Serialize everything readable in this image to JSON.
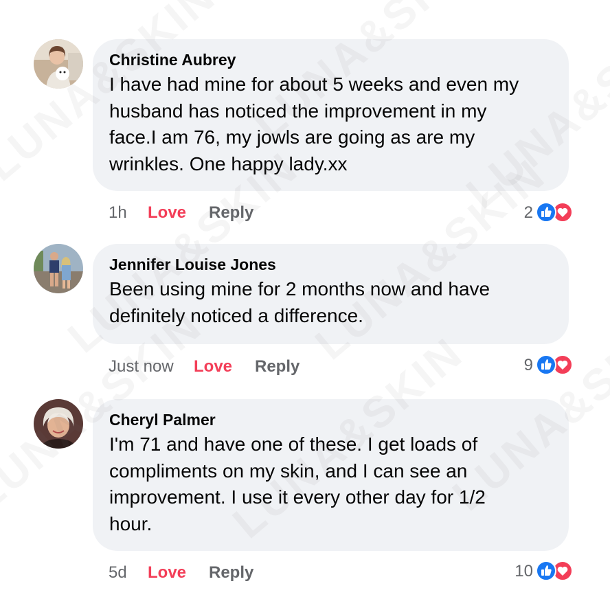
{
  "watermark": "LUNA&SKIN",
  "comments": [
    {
      "name": "Christine Aubrey",
      "lines": [
        "I have had mine for about 5 weeks and even my",
        "husband has noticed the improvement in my",
        "face.I am 76, my jowls are going as are my",
        "wrinkles. One happy lady.xx"
      ],
      "time": "1h",
      "love_label": "Love",
      "reply_label": "Reply",
      "reaction_count": "2"
    },
    {
      "name": "Jennifer Louise Jones",
      "lines": [
        "Been using mine for 2 months now and have",
        "definitely noticed a difference."
      ],
      "time": "Just now",
      "love_label": "Love",
      "reply_label": "Reply",
      "reaction_count": "9"
    },
    {
      "name": "Cheryl Palmer",
      "lines": [
        "I'm 71 and have one of these. I get loads of",
        "compliments on my skin, and I can see an",
        "improvement. I use it every other day for 1/2",
        "hour."
      ],
      "time": "5d",
      "love_label": "Love",
      "reply_label": "Reply",
      "reaction_count": "10"
    }
  ],
  "icons": {
    "like": "like-reaction-icon",
    "love": "love-reaction-icon"
  },
  "colors": {
    "bubble": "#f0f2f5",
    "love_action": "#f33e58",
    "like_blue": "#1877f2",
    "love_red": "#f33e58",
    "muted": "#65676b"
  }
}
